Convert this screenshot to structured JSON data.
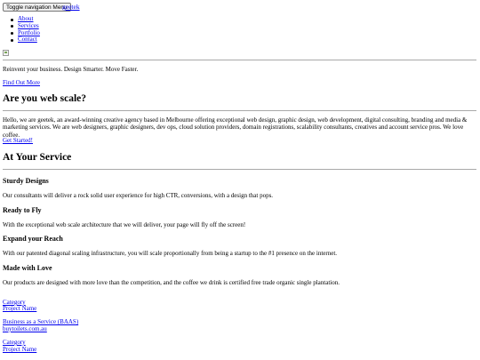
{
  "navbar": {
    "toggle_label": "Toggle navigation Menu",
    "brand": "geetek",
    "items": [
      {
        "label": "About"
      },
      {
        "label": "Services"
      },
      {
        "label": "Portfolio"
      },
      {
        "label": "Contact"
      }
    ]
  },
  "hero": {
    "tagline": "Reinvent your business. Design Smarter. Move Faster.",
    "cta": "Find Out More"
  },
  "about": {
    "heading": "Are you web scale?",
    "body": "Hello, we are geetek, an award-winning creative agency based in Melbourne offering exceptional web design, graphic design, web development, digital consulting, branding and media & marketing services. We are web designers, graphic designers, dev ops, cloud solution providers, domain registrations, scalability consultants, creatives and account service pros. We love coffee.",
    "cta": "Get Started!"
  },
  "services": {
    "heading": "At Your Service",
    "items": [
      {
        "title": "Sturdy Designs",
        "text": "Our consultants will deliver a rock solid user experience for high CTR, conversions, with a design that pops."
      },
      {
        "title": "Ready to Fly",
        "text": "With the exceptional web scale architecture that we will deliver, your page will fly off the screen!"
      },
      {
        "title": "Expand your Reach",
        "text": "With our patented diagonal scaling infrastructure, you will scale proportionally from being a startup to the #1 presence on the internet."
      },
      {
        "title": "Made with Love",
        "text": "Our products are designed with more love than the competition, and the coffee we drink is certified free trade organic single plantation."
      }
    ]
  },
  "portfolio": {
    "items": [
      {
        "category": "Category",
        "name": "Project Name"
      },
      {
        "category": "Business as a Service (BAAS)",
        "name": "buytoilets.com.au"
      },
      {
        "category": "Category",
        "name": "Project Name"
      }
    ]
  }
}
